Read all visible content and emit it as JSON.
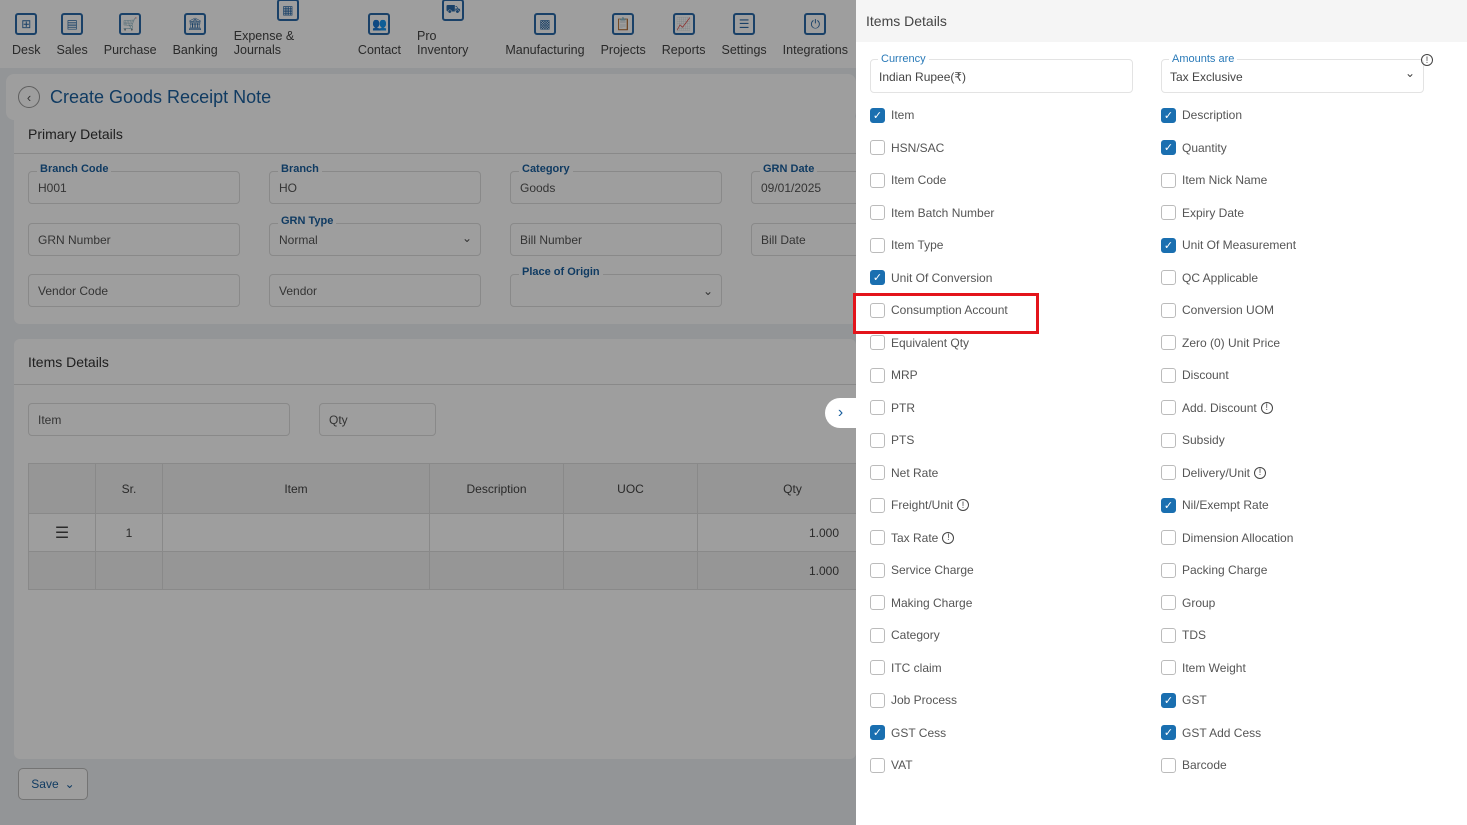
{
  "nav": [
    {
      "label": "Desk",
      "icon": "desk-icon"
    },
    {
      "label": "Sales",
      "icon": "sales-icon"
    },
    {
      "label": "Purchase",
      "icon": "cart-icon"
    },
    {
      "label": "Banking",
      "icon": "bank-icon"
    },
    {
      "label": "Expense & Journals",
      "icon": "journal-icon"
    },
    {
      "label": "Contact",
      "icon": "contact-icon"
    },
    {
      "label": "Pro Inventory",
      "icon": "inventory-icon"
    },
    {
      "label": "Manufacturing",
      "icon": "factory-icon"
    },
    {
      "label": "Projects",
      "icon": "projects-icon"
    },
    {
      "label": "Reports",
      "icon": "reports-icon"
    },
    {
      "label": "Settings",
      "icon": "sliders-icon"
    },
    {
      "label": "Integrations",
      "icon": "plug-icon"
    }
  ],
  "page": {
    "title": "Create Goods Receipt Note",
    "primary": {
      "heading": "Primary Details",
      "branch_code": {
        "label": "Branch Code",
        "value": "H001"
      },
      "branch": {
        "label": "Branch",
        "value": "HO"
      },
      "category": {
        "label": "Category",
        "value": "Goods"
      },
      "grn_date": {
        "label": "GRN Date",
        "value": "09/01/2025"
      },
      "grn_number": {
        "placeholder": "GRN Number"
      },
      "grn_type": {
        "label": "GRN Type",
        "value": "Normal"
      },
      "bill_number": {
        "placeholder": "Bill Number"
      },
      "bill_date": {
        "placeholder": "Bill Date"
      },
      "vendor_code": {
        "placeholder": "Vendor Code"
      },
      "vendor": {
        "placeholder": "Vendor"
      },
      "place_of_origin": {
        "label": "Place of Origin",
        "value": ""
      }
    },
    "items": {
      "heading": "Items Details",
      "item_placeholder": "Item",
      "qty_placeholder": "Qty",
      "columns": [
        "Sr.",
        "Item",
        "Description",
        "UOC",
        "Qty"
      ],
      "rows": [
        {
          "sr": "1",
          "qty": "1.000"
        }
      ],
      "total_qty": "1.000"
    },
    "save_label": "Save"
  },
  "panel": {
    "title": "Items Details",
    "currency": {
      "label": "Currency",
      "value": "Indian Rupee(₹)"
    },
    "amounts": {
      "label": "Amounts are",
      "value": "Tax Exclusive"
    },
    "left": [
      {
        "label": "Item",
        "checked": true
      },
      {
        "label": "HSN/SAC",
        "checked": false
      },
      {
        "label": "Item Code",
        "checked": false
      },
      {
        "label": "Item Batch Number",
        "checked": false
      },
      {
        "label": "Item Type",
        "checked": false
      },
      {
        "label": "Unit Of Conversion",
        "checked": true
      },
      {
        "label": "Consumption Account",
        "checked": false,
        "highlighted": true
      },
      {
        "label": "Equivalent Qty",
        "checked": false
      },
      {
        "label": "MRP",
        "checked": false
      },
      {
        "label": "PTR",
        "checked": false
      },
      {
        "label": "PTS",
        "checked": false
      },
      {
        "label": "Net Rate",
        "checked": false
      },
      {
        "label": "Freight/Unit",
        "checked": false,
        "info": true
      },
      {
        "label": "Tax Rate",
        "checked": false,
        "info": true
      },
      {
        "label": "Service Charge",
        "checked": false
      },
      {
        "label": "Making Charge",
        "checked": false
      },
      {
        "label": "Category",
        "checked": false
      },
      {
        "label": "ITC claim",
        "checked": false
      },
      {
        "label": "Job Process",
        "checked": false
      },
      {
        "label": "GST Cess",
        "checked": true
      },
      {
        "label": "VAT",
        "checked": false
      }
    ],
    "right": [
      {
        "label": "Description",
        "checked": true
      },
      {
        "label": "Quantity",
        "checked": true
      },
      {
        "label": "Item Nick Name",
        "checked": false
      },
      {
        "label": "Expiry Date",
        "checked": false
      },
      {
        "label": "Unit Of Measurement",
        "checked": true
      },
      {
        "label": "QC Applicable",
        "checked": false
      },
      {
        "label": "Conversion UOM",
        "checked": false
      },
      {
        "label": "Zero (0) Unit Price",
        "checked": false
      },
      {
        "label": "Discount",
        "checked": false
      },
      {
        "label": "Add. Discount",
        "checked": false,
        "info": true
      },
      {
        "label": "Subsidy",
        "checked": false
      },
      {
        "label": "Delivery/Unit",
        "checked": false,
        "info": true
      },
      {
        "label": "Nil/Exempt Rate",
        "checked": true
      },
      {
        "label": "Dimension Allocation",
        "checked": false
      },
      {
        "label": "Packing Charge",
        "checked": false
      },
      {
        "label": "Group",
        "checked": false
      },
      {
        "label": "TDS",
        "checked": false
      },
      {
        "label": "Item Weight",
        "checked": false
      },
      {
        "label": "GST",
        "checked": true
      },
      {
        "label": "GST Add Cess",
        "checked": true
      },
      {
        "label": "Barcode",
        "checked": false
      }
    ]
  },
  "colors": {
    "accent": "#1a6fb0",
    "highlight": "#e3141b"
  }
}
